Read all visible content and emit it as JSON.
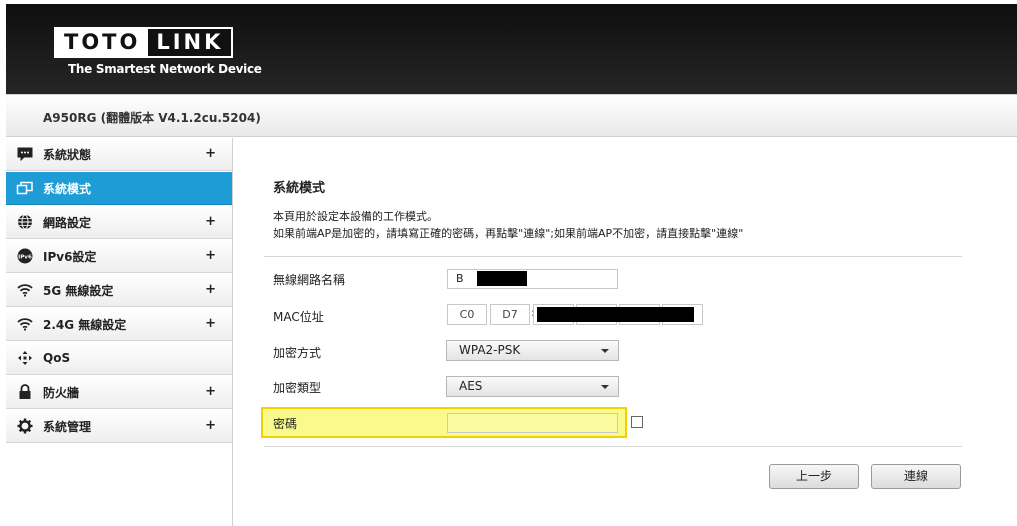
{
  "header": {
    "logo_left": "TOTO",
    "logo_right": "LINK",
    "tagline": "The Smartest Network Device"
  },
  "version": "A950RG (翻體版本 V4.1.2cu.5204)",
  "sidebar": {
    "items": [
      {
        "label": "系統狀態",
        "icon": "chat-bubble-icon",
        "expandable": "+"
      },
      {
        "label": "系統模式",
        "icon": "network-mode-icon",
        "expandable": ""
      },
      {
        "label": "網路設定",
        "icon": "globe-icon",
        "expandable": "+"
      },
      {
        "label": "IPv6設定",
        "icon": "ipv6-icon",
        "expandable": "+"
      },
      {
        "label": "5G 無線設定",
        "icon": "wifi-icon",
        "expandable": "+"
      },
      {
        "label": "2.4G 無線設定",
        "icon": "wifi-icon",
        "expandable": "+"
      },
      {
        "label": "QoS",
        "icon": "qos-arrows-icon",
        "expandable": ""
      },
      {
        "label": "防火牆",
        "icon": "lock-icon",
        "expandable": "+"
      },
      {
        "label": "系統管理",
        "icon": "gear-icon",
        "expandable": "+"
      }
    ],
    "active_index": 1,
    "active_color": "#1e9cd6"
  },
  "main": {
    "title": "系統模式",
    "desc_line1": "本頁用於設定本設備的工作模式。",
    "desc_line2": "如果前端AP是加密的，請填寫正確的密碼，再點擊\"連線\";如果前端AP不加密，請直接點擊\"連線\"",
    "form": {
      "ssid_label": "無線網路名稱",
      "ssid_value": "B",
      "mac_label": "MAC位址",
      "mac_values": [
        "C0",
        "D7",
        "",
        "",
        "",
        ""
      ],
      "encryption_label": "加密方式",
      "encryption_value": "WPA2-PSK",
      "cipher_label": "加密類型",
      "cipher_value": "AES",
      "password_label": "密碼",
      "password_value": ""
    },
    "buttons": {
      "prev": "上一步",
      "connect": "連線"
    }
  }
}
